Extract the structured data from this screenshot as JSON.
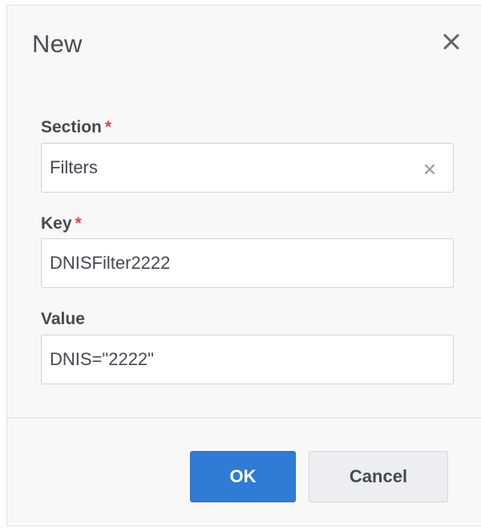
{
  "dialog": {
    "title": "New"
  },
  "form": {
    "section": {
      "label": "Section",
      "required_mark": "*",
      "value": "Filters"
    },
    "key": {
      "label": "Key",
      "required_mark": "*",
      "value": "DNISFilter2222"
    },
    "value": {
      "label": "Value",
      "value": "DNIS=\"2222\""
    }
  },
  "buttons": {
    "ok_label": "OK",
    "cancel_label": "Cancel"
  },
  "colors": {
    "primary_button": "#2f7bd6",
    "required_asterisk": "#e0434f"
  },
  "icons": {
    "close": "close-icon",
    "clear": "clear-icon"
  }
}
